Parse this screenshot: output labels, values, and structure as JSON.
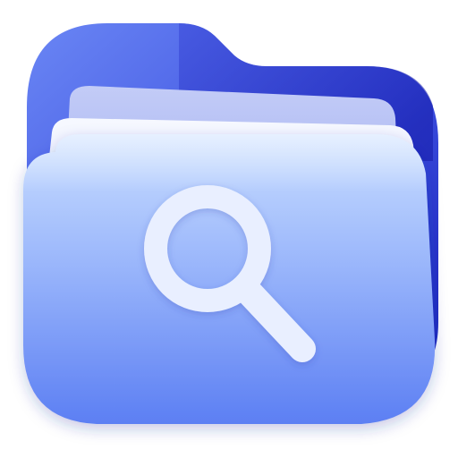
{
  "icon": {
    "name": "folder-search-app-icon",
    "symbol": "magnifying-glass-icon"
  },
  "colors": {
    "background": "#ffffff",
    "folder_back_light": "#5a78f0",
    "folder_back_dark": "#1a22b8",
    "folder_tab": "#2430c8",
    "paper_back": "#b8c4f6",
    "paper_front": "#f4f7ff",
    "folder_front_top": "#c6dcff",
    "folder_front_bottom": "#5f82f4",
    "glass": "#e9efff"
  }
}
